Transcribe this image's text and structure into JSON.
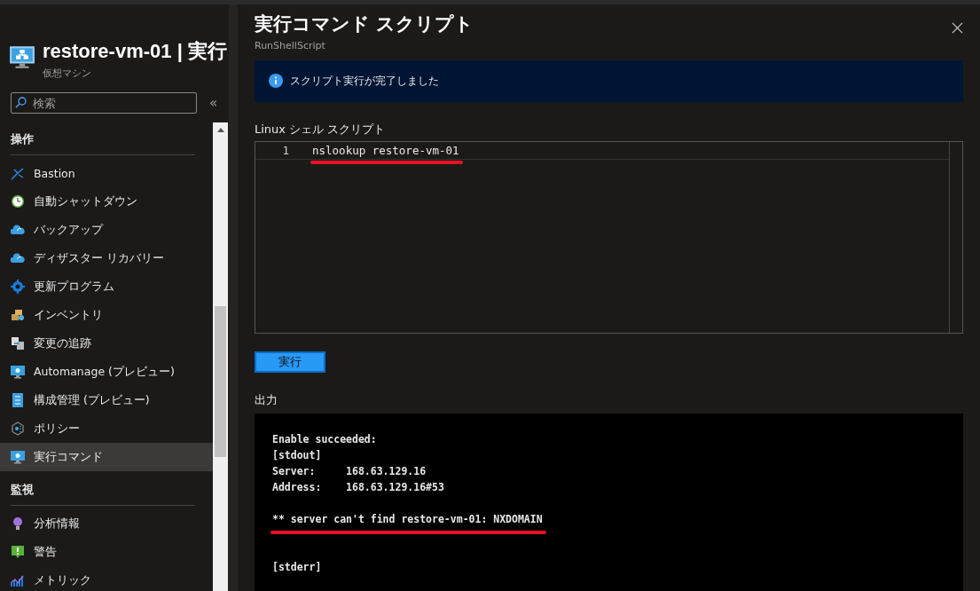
{
  "resource": {
    "name": "restore-vm-01 | 実行",
    "type": "仮想マシン"
  },
  "search": {
    "placeholder": "検索"
  },
  "collapse": "«",
  "sidebar": {
    "sections": [
      {
        "title": "操作",
        "items": [
          {
            "label": "Bastion",
            "selected": false
          },
          {
            "label": "自動シャットダウン",
            "selected": false
          },
          {
            "label": "バックアップ",
            "selected": false
          },
          {
            "label": "ディザスター リカバリー",
            "selected": false
          },
          {
            "label": "更新プログラム",
            "selected": false
          },
          {
            "label": "インベントリ",
            "selected": false
          },
          {
            "label": "変更の追跡",
            "selected": false
          },
          {
            "label": "Automanage (プレビュー)",
            "selected": false
          },
          {
            "label": "構成管理 (プレビュー)",
            "selected": false
          },
          {
            "label": "ポリシー",
            "selected": false
          },
          {
            "label": "実行コマンド",
            "selected": true
          }
        ]
      },
      {
        "title": "監視",
        "items": [
          {
            "label": "分析情報",
            "selected": false
          },
          {
            "label": "警告",
            "selected": false
          },
          {
            "label": "メトリック",
            "selected": false
          }
        ]
      }
    ]
  },
  "panel": {
    "title": "実行コマンド スクリプト",
    "subtitle": "RunShellScript",
    "notice": "スクリプト実行が完了しました",
    "script_label": "Linux シェル スクリプト",
    "code_lines": [
      {
        "number": "1",
        "text": "nslookup restore-vm-01",
        "underlined": true
      }
    ],
    "run_button": "実行",
    "output_label": "出力",
    "output_blocks": [
      [
        {
          "text": "Enable succeeded:",
          "underlined": false
        },
        {
          "text": "[stdout]",
          "underlined": false
        },
        {
          "text": "Server:     168.63.129.16",
          "underlined": false
        },
        {
          "text": "Address:    168.63.129.16#53",
          "underlined": false
        }
      ],
      [
        {
          "text": "** server can't find restore-vm-01: NXDOMAIN",
          "underlined": true
        }
      ],
      [
        {
          "text": "[stderr]",
          "underlined": false
        }
      ]
    ]
  }
}
